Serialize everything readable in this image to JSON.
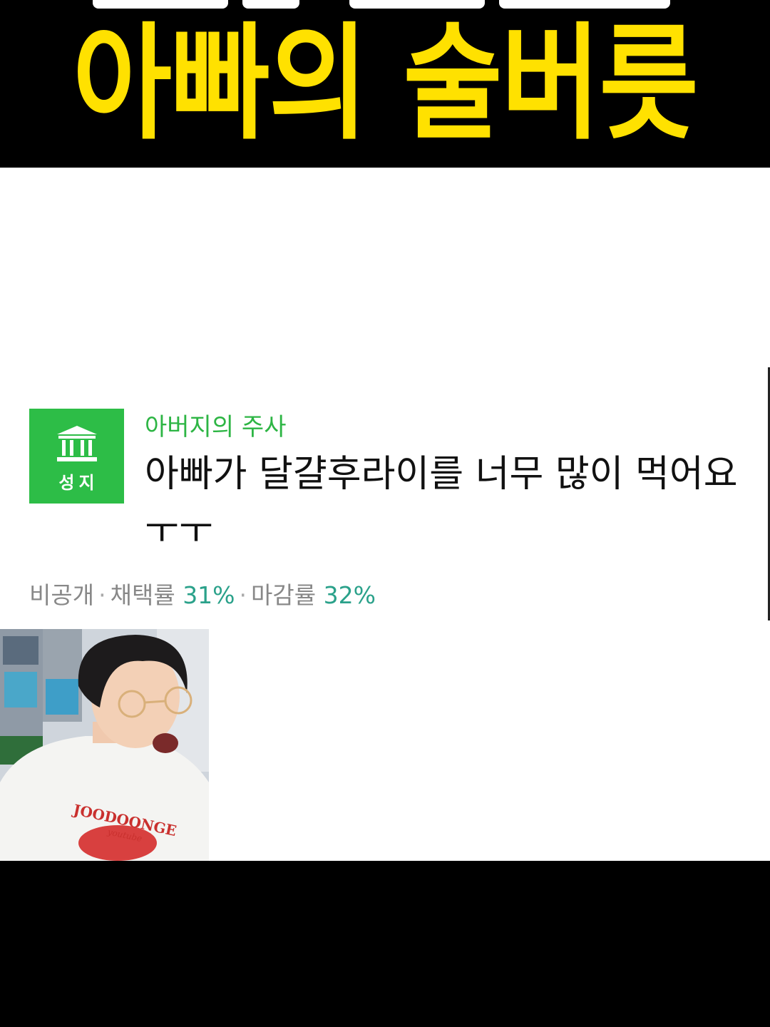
{
  "banner": {
    "title": "아빠의 술버릇",
    "title_color": "#ffe100"
  },
  "question": {
    "badge_label": "성지",
    "badge_color": "#2dbd47",
    "badge_icon": "bank-icon",
    "category": "아버지의 주사",
    "title": "아빠가 달걀후라이를 너무 많이 먹어요ㅜㅜ",
    "meta": {
      "visibility": "비공개",
      "adoption_label": "채택률",
      "adoption_rate": "31%",
      "closing_label": "마감률",
      "closing_rate": "32%"
    }
  },
  "webcam": {
    "shirt_text": "JOODOONGE",
    "shirt_subtext": "youtube"
  }
}
